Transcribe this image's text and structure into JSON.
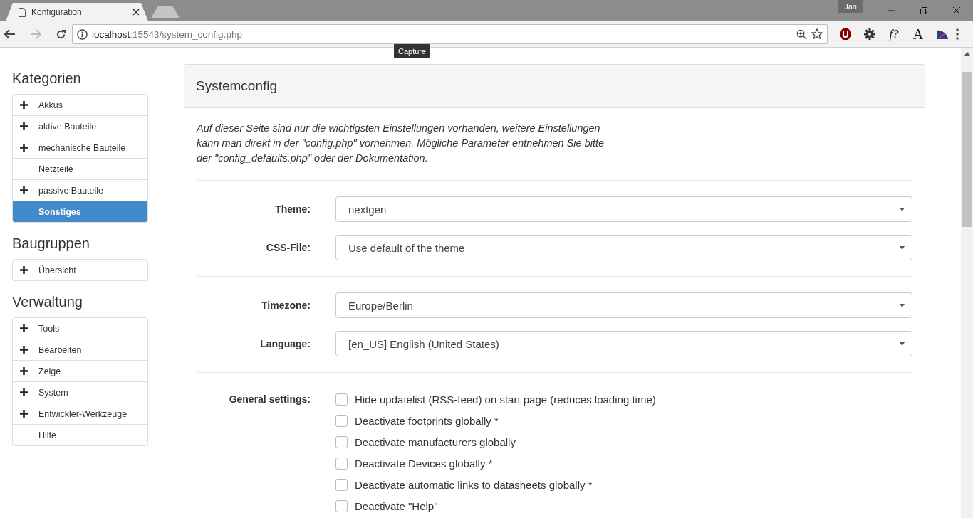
{
  "browser": {
    "tabs": [
      {
        "title": "Konfiguration",
        "selected": true
      },
      {
        "selected": false
      }
    ],
    "profile": "Jan",
    "address": {
      "host": "localhost",
      "path": ":15543/system_config.php"
    },
    "tooltip": "Capture",
    "extensions": [
      {
        "kind": "ublock"
      },
      {
        "kind": "gear"
      },
      {
        "kind": "font-q",
        "text": "f?"
      },
      {
        "kind": "font-size",
        "text": "A"
      },
      {
        "kind": "speed"
      }
    ]
  },
  "sidebar": {
    "sections": [
      {
        "title": "Kategorien",
        "items": [
          {
            "label": "Akkus",
            "expandable": true,
            "selected": false
          },
          {
            "label": "aktive Bauteile",
            "expandable": true,
            "selected": false
          },
          {
            "label": "mechanische Bauteile",
            "expandable": true,
            "selected": false
          },
          {
            "label": "Netzteile",
            "expandable": false,
            "selected": false
          },
          {
            "label": "passive Bauteile",
            "expandable": true,
            "selected": false
          },
          {
            "label": "Sonstiges",
            "expandable": false,
            "selected": true
          }
        ]
      },
      {
        "title": "Baugruppen",
        "items": [
          {
            "label": "Übersicht",
            "expandable": true,
            "selected": false
          }
        ]
      },
      {
        "title": "Verwaltung",
        "items": [
          {
            "label": "Tools",
            "expandable": true,
            "selected": false
          },
          {
            "label": "Bearbeiten",
            "expandable": true,
            "selected": false
          },
          {
            "label": "Zeige",
            "expandable": true,
            "selected": false
          },
          {
            "label": "System",
            "expandable": true,
            "selected": false
          },
          {
            "label": "Entwickler-Werkzeuge",
            "expandable": true,
            "selected": false
          },
          {
            "label": "Hilfe",
            "expandable": false,
            "selected": false
          }
        ]
      }
    ]
  },
  "panel": {
    "title": "Systemconfig",
    "intro": "Auf dieser Seite sind nur die wichtigsten Einstellungen vorhanden, weitere Einstellungen kann man direkt in der \"config.php\" vornehmen. Mögliche Parameter entnehmen Sie bitte der \"config_defaults.php\" oder der Dokumentation.",
    "groups": [
      [
        {
          "kind": "select",
          "label": "Theme:",
          "value": "nextgen"
        },
        {
          "kind": "select",
          "label": "CSS-File:",
          "value": "Use default of the theme"
        }
      ],
      [
        {
          "kind": "select",
          "label": "Timezone:",
          "value": "Europe/Berlin"
        },
        {
          "kind": "select",
          "label": "Language:",
          "value": "[en_US] English (United States)"
        }
      ],
      [
        {
          "kind": "checks",
          "label": "General settings:",
          "options": [
            {
              "label": "Hide updatelist (RSS-feed) on start page (reduces loading time)",
              "checked": false
            },
            {
              "label": "Deactivate footprints globally *",
              "checked": false
            },
            {
              "label": "Deactivate manufacturers globally",
              "checked": false
            },
            {
              "label": "Deactivate Devices globally *",
              "checked": false
            },
            {
              "label": "Deactivate automatic links to datasheets globally *",
              "checked": false
            },
            {
              "label": "Deactivate \"Help\"",
              "checked": false
            }
          ]
        }
      ]
    ]
  }
}
